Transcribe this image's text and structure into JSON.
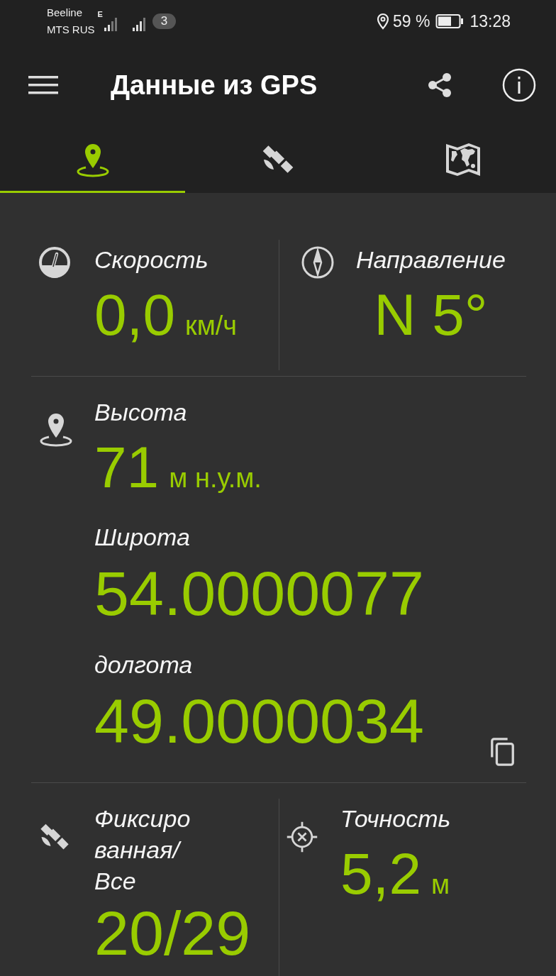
{
  "status_bar": {
    "carriers": [
      "Beeline",
      "MTS RUS"
    ],
    "network_type": "E",
    "sim_badge": "3",
    "battery_percent": "59 %",
    "time": "13:28"
  },
  "toolbar": {
    "title": "Данные из GPS"
  },
  "tabs": [
    {
      "kind": "location",
      "selected": true
    },
    {
      "kind": "satellite",
      "selected": false
    },
    {
      "kind": "map",
      "selected": false
    }
  ],
  "speed": {
    "label": "Скорость",
    "value": "0,0",
    "unit": "км/ч"
  },
  "direction": {
    "label": "Направление",
    "value": "N 5°"
  },
  "altitude": {
    "label": "Высота",
    "value": "71",
    "unit": "м н.у.м."
  },
  "latitude": {
    "label": "Широта",
    "value": "54.0000077"
  },
  "longitude": {
    "label": "долгота",
    "value": "49.0000034"
  },
  "satellites": {
    "label": "Фиксиро ванная/ Все",
    "value": "20/29"
  },
  "accuracy": {
    "label": "Точность",
    "value": "5,2",
    "unit": "м"
  }
}
